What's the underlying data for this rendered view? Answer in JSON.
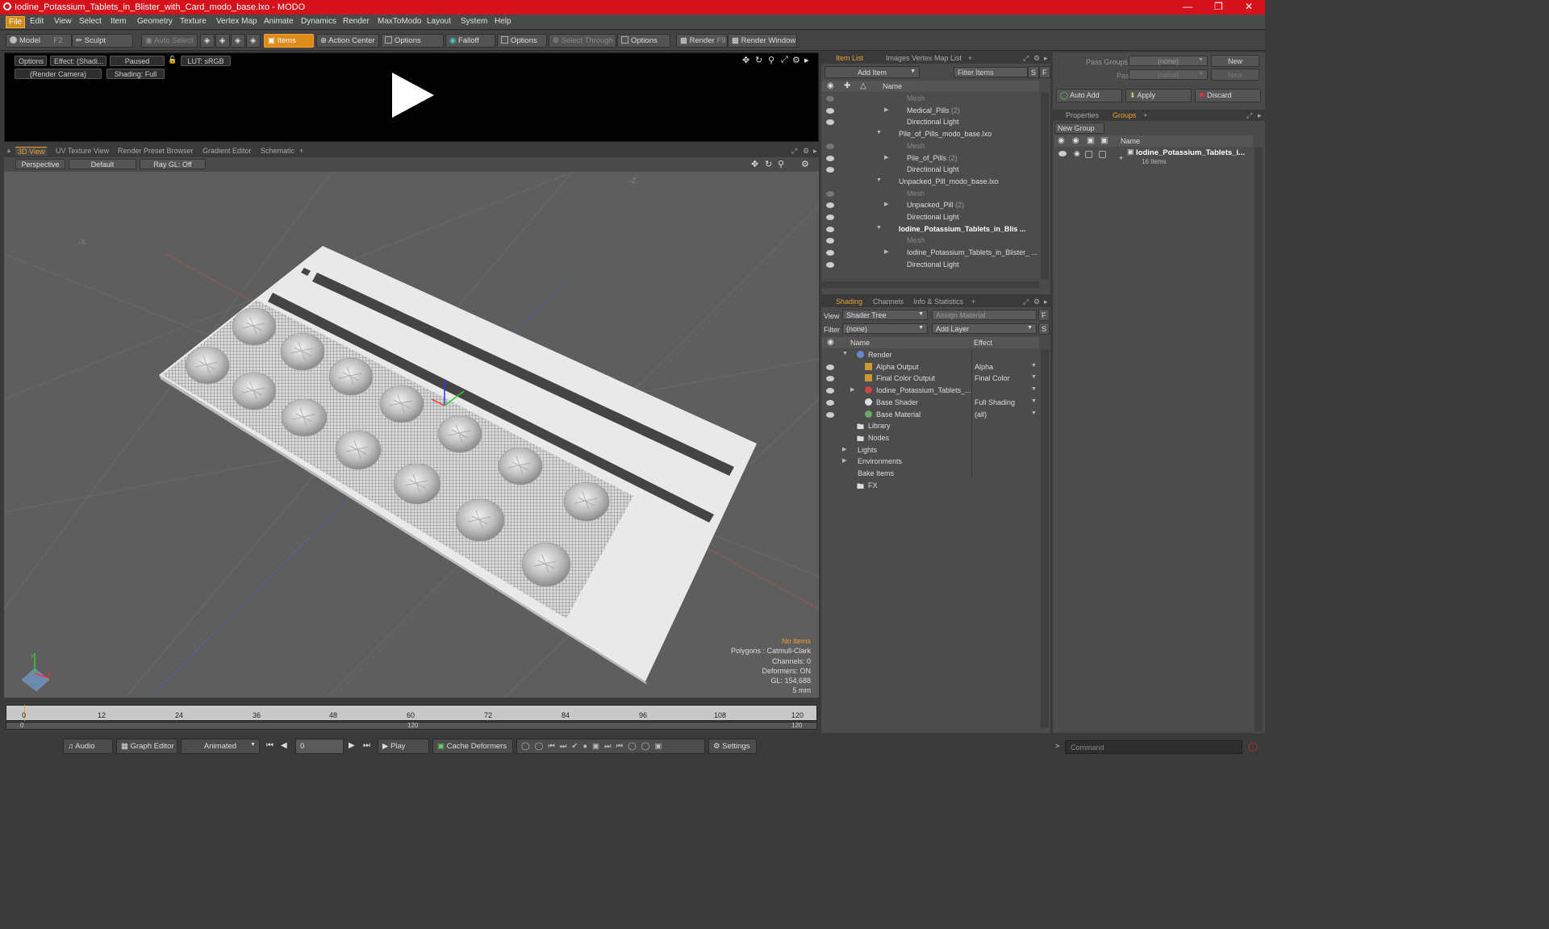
{
  "window": {
    "title": "Iodine_Potassium_Tablets_in_Blister_with_Card_modo_base.lxo - MODO"
  },
  "menu": [
    "File",
    "Edit",
    "View",
    "Select",
    "Item",
    "Geometry",
    "Texture",
    "Vertex Map",
    "Animate",
    "Dynamics",
    "Render",
    "MaxToModo",
    "Layout",
    "System",
    "Help"
  ],
  "toolbar": {
    "model": "Model",
    "model_key": "F2",
    "sculpt": "Sculpt",
    "auto_select": "Auto Select",
    "items": "Items",
    "action_center": "Action Center",
    "options1": "Options",
    "falloff": "Falloff",
    "options2": "Options",
    "select_through": "Select Through",
    "options3": "Options",
    "render": "Render",
    "render_key": "F9",
    "render_window": "Render Window"
  },
  "preview": {
    "options": "Options",
    "effect": "Effect: (Shadi...",
    "paused": "Paused",
    "lut": "LUT: sRGB",
    "camera": "(Render Camera)",
    "shading": "Shading: Full"
  },
  "view_tabs": [
    "3D View",
    "UV Texture View",
    "Render Preset Browser",
    "Gradient Editor",
    "Schematic"
  ],
  "viewport": {
    "perspective": "Perspective",
    "default": "Default",
    "raygl": "Ray GL: Off",
    "stats": [
      "No Items",
      "Polygons : Catmull-Clark",
      "Channels: 0",
      "Deformers: ON",
      "GL: 154,688",
      "5 mm"
    ]
  },
  "timeline": {
    "ticks": [
      "0",
      "12",
      "24",
      "36",
      "48",
      "60",
      "72",
      "84",
      "96",
      "108",
      "120"
    ],
    "start": "0",
    "mid": "120",
    "end": "120"
  },
  "bottom": {
    "audio": "Audio",
    "graph_editor": "Graph Editor",
    "animated": "Animated",
    "frame": "0",
    "play": "Play",
    "cache": "Cache Deformers",
    "settings": "Settings",
    "command": "Command"
  },
  "item_list": {
    "tabs": [
      "Item List",
      "Images",
      "Vertex Map List"
    ],
    "add_item": "Add Item",
    "filter": "Filter Items",
    "s": "S",
    "f": "F",
    "col_name": "Name",
    "rows": [
      {
        "label": "Mesh",
        "dim": true,
        "indent": 1
      },
      {
        "label": "Medical_Pills",
        "count": "(2)",
        "indent": 1
      },
      {
        "label": "Directional Light",
        "indent": 1
      },
      {
        "label": "Pile_of_Pills_modo_base.lxo",
        "indent": 0
      },
      {
        "label": "Mesh",
        "dim": true,
        "indent": 1
      },
      {
        "label": "Pile_of_Pills",
        "count": "(2)",
        "indent": 1
      },
      {
        "label": "Directional Light",
        "indent": 1
      },
      {
        "label": "Unpacked_Pill_modo_base.lxo",
        "indent": 0
      },
      {
        "label": "Mesh",
        "dim": true,
        "indent": 1
      },
      {
        "label": "Unpacked_Pill",
        "count": "(2)",
        "indent": 1
      },
      {
        "label": "Directional Light",
        "indent": 1
      },
      {
        "label": "Iodine_Potassium_Tablets_in_Blis ...",
        "bold": true,
        "indent": 0
      },
      {
        "label": "Mesh",
        "dim": true,
        "indent": 1
      },
      {
        "label": "Iodine_Potassium_Tablets_in_Blister_ ...",
        "indent": 1
      },
      {
        "label": "Directional Light",
        "indent": 1
      }
    ]
  },
  "shading": {
    "tabs": [
      "Shading",
      "Channels",
      "Info & Statistics"
    ],
    "view_label": "View",
    "view_value": "Shader Tree",
    "assign": "Assign Material",
    "f": "F",
    "filter_label": "Filter",
    "filter_value": "(none)",
    "add_layer": "Add Layer",
    "s": "S",
    "col_name": "Name",
    "col_effect": "Effect",
    "rows": [
      {
        "label": "Render",
        "effect": "",
        "indent": 0
      },
      {
        "label": "Alpha Output",
        "effect": "Alpha",
        "indent": 1
      },
      {
        "label": "Final Color Output",
        "effect": "Final Color",
        "indent": 1
      },
      {
        "label": "Iodine_Potassium_Tablets_...",
        "effect": "",
        "indent": 1
      },
      {
        "label": "Base Shader",
        "effect": "Full Shading",
        "indent": 1
      },
      {
        "label": "Base Material",
        "effect": "(all)",
        "indent": 1
      },
      {
        "label": "Library",
        "effect": "",
        "indent": 0
      },
      {
        "label": "Nodes",
        "effect": "",
        "indent": 0
      },
      {
        "label": "Lights",
        "effect": "",
        "indent": 0
      },
      {
        "label": "Environments",
        "effect": "",
        "indent": 0
      },
      {
        "label": "Bake Items",
        "effect": "",
        "indent": 0
      },
      {
        "label": "FX",
        "effect": "",
        "indent": 0
      }
    ]
  },
  "right": {
    "pass_groups": "Pass Groups",
    "passes": "Passes",
    "none": "(none)",
    "new": "New",
    "auto_add": "Auto Add",
    "apply": "Apply",
    "discard": "Discard",
    "tabs": [
      "Properties",
      "Groups"
    ],
    "new_group": "New Group",
    "col_name": "Name",
    "group_name": "Iodine_Potassium_Tablets_i...",
    "group_count": "16 Items"
  }
}
